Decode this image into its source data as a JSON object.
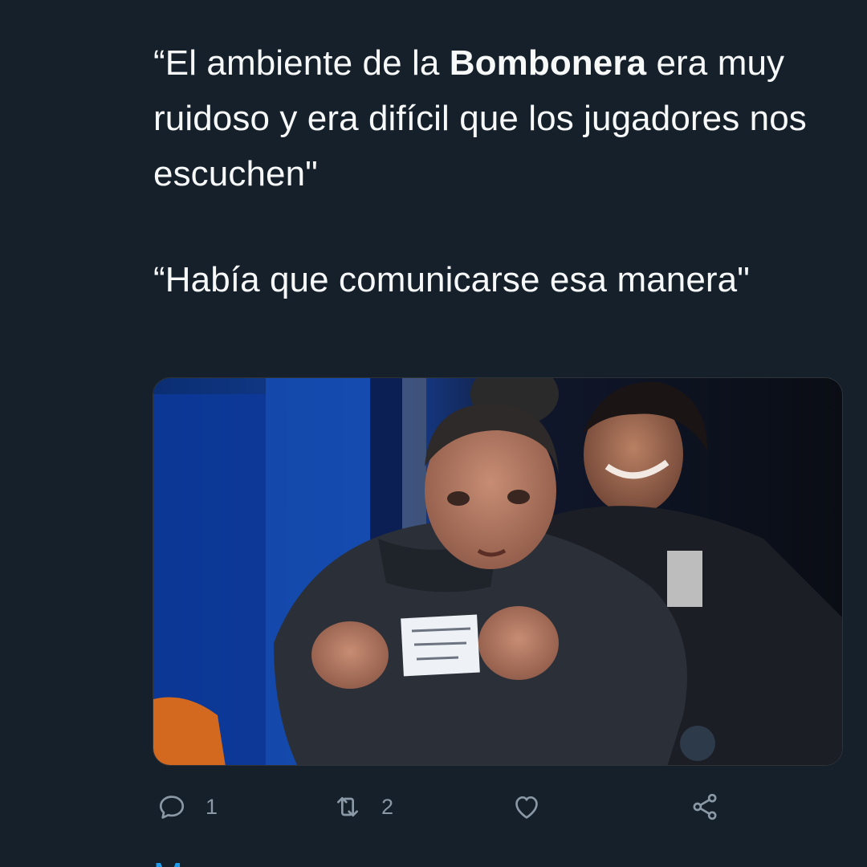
{
  "tweet": {
    "paragraph_1": {
      "before": "“El ambiente de la ",
      "bold": "Bombonera",
      "after": " era muy ruidoso y era difícil que los jugadores nos escuchen\""
    },
    "paragraph_2": "“Había que comunicarse esa manera\""
  },
  "actions": {
    "reply_count": "1",
    "retweet_count": "2"
  },
  "more_link": "Mo"
}
